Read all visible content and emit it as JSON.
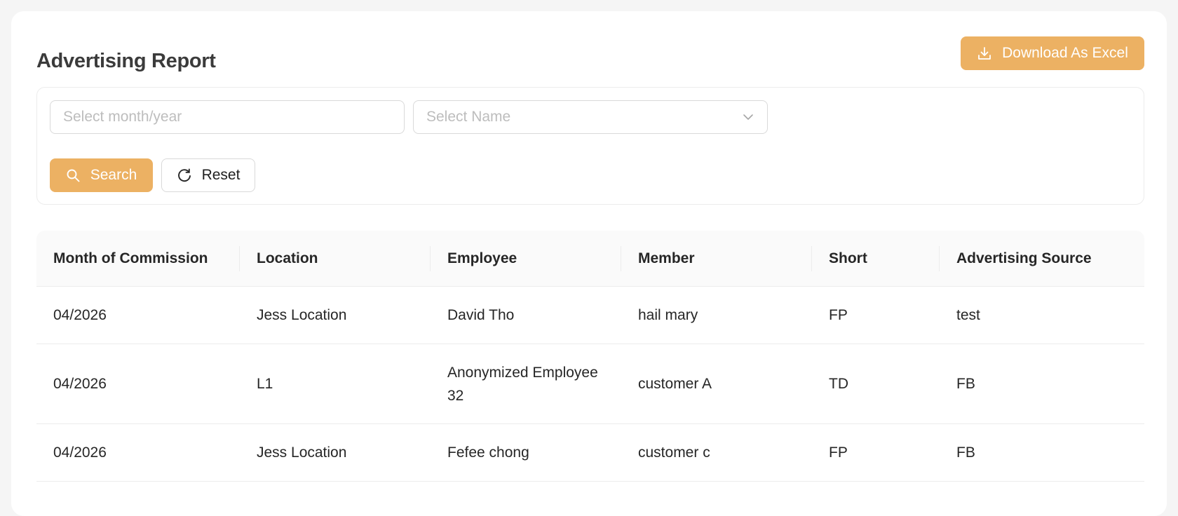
{
  "header": {
    "title": "Advertising Report",
    "download_label": "Download As Excel"
  },
  "filters": {
    "month_placeholder": "Select month/year",
    "name_placeholder": "Select Name",
    "search_label": "Search",
    "reset_label": "Reset"
  },
  "table": {
    "columns": [
      "Month of Commission",
      "Location",
      "Employee",
      "Member",
      "Short",
      "Advertising Source"
    ],
    "rows": [
      [
        "04/2026",
        "Jess Location",
        "David Tho",
        "hail mary",
        "FP",
        "test"
      ],
      [
        "04/2026",
        "L1",
        "Anonymized Employee 32",
        "customer A",
        "TD",
        "FB"
      ],
      [
        "04/2026",
        "Jess Location",
        "Fefee chong",
        "customer c",
        "FP",
        "FB"
      ]
    ]
  },
  "colors": {
    "primary": "#ecb163",
    "border": "#d9d9d9",
    "header_bg": "#fafafa"
  },
  "icons": {
    "download": "download-icon",
    "search": "search-icon",
    "reset": "reload-icon",
    "dropdown": "chevron-down-icon"
  }
}
